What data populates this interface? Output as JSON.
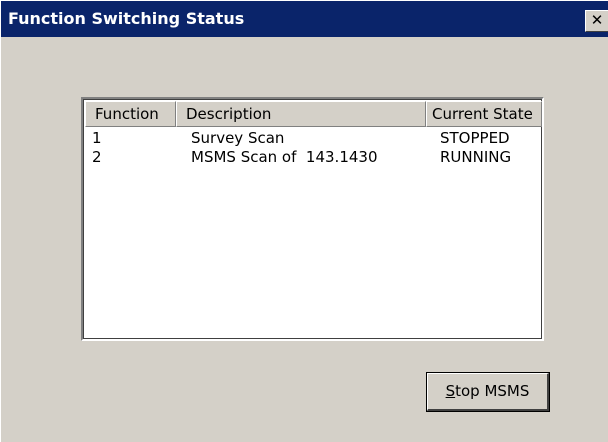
{
  "window": {
    "title": "Function Switching Status",
    "close_glyph": "✕",
    "title_bar_color": "#0a246a",
    "face_color": "#d4d0c8"
  },
  "list": {
    "columns": [
      "Function",
      "Description",
      "Current State"
    ],
    "rows": [
      {
        "function": "1",
        "description": "Survey Scan",
        "state": "STOPPED"
      },
      {
        "function": "2",
        "description": "MSMS Scan of  143.1430",
        "state": "RUNNING"
      }
    ]
  },
  "buttons": {
    "stop_msms_accel": "S",
    "stop_msms_rest": "top MSMS"
  }
}
